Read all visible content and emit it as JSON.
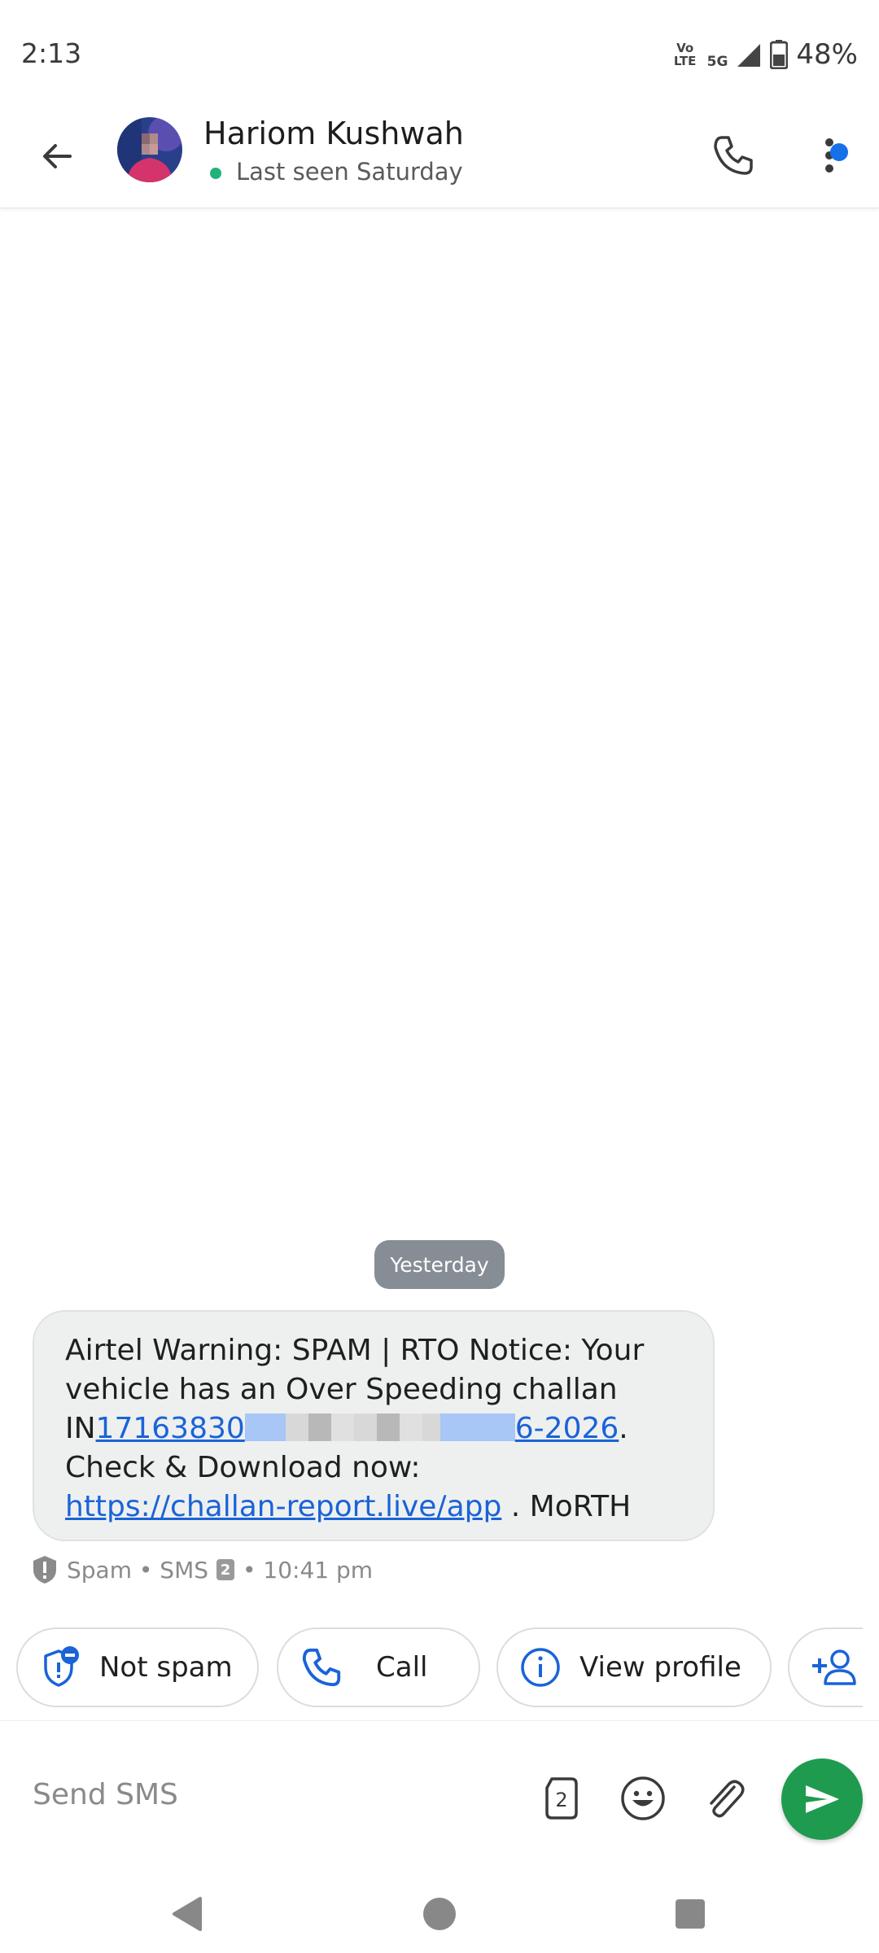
{
  "status_bar": {
    "time": "2:13",
    "volte": "Vo\nLTE",
    "network": "5G",
    "battery": "48%"
  },
  "header": {
    "contact_name": "Hariom Kushwah",
    "last_seen": "Last seen Saturday",
    "online_dot_color": "#1fb37a",
    "menu_badge_color": "#1670e8"
  },
  "chat": {
    "date_chip": "Yesterday",
    "message": {
      "line1": "Airtel Warning: SPAM | RTO Notice: Your vehicle has an Over Speeding challan",
      "prefix": "IN",
      "link_part1": "17163830",
      "link_part2": "6-2026",
      "after_link": ".",
      "line4": "Check & Download now:",
      "url": "https://challan-report.live/app",
      "suffix": " . MoRTH"
    },
    "meta": {
      "label": "Spam • SMS",
      "sim": "2",
      "time": "• 10:41 pm"
    }
  },
  "actions": {
    "not_spam": "Not spam",
    "call": "Call",
    "view_profile": "View profile"
  },
  "composer": {
    "placeholder": "Send SMS",
    "sim": "2",
    "send_color": "#1e9b4e"
  }
}
